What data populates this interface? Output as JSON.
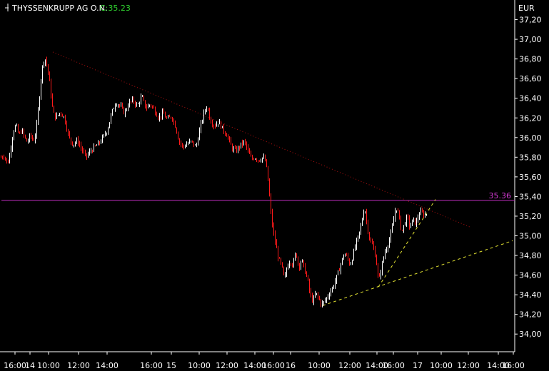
{
  "header": {
    "title": "THYSSENKRUPP AG O.N.",
    "close_label": "C:35.23"
  },
  "currency": "EUR",
  "colors": {
    "background": "#000000",
    "up": "#ffffff",
    "down": "#ff1a1a",
    "close_text": "#2fd12f",
    "hline": "#c02ec0",
    "resistance": "#b01010",
    "support": "#e6e632"
  },
  "chart_data": {
    "type": "candlestick",
    "title": "THYSSENKRUPP AG O.N.",
    "last_close": 35.23,
    "ylabel": "EUR",
    "ylim": [
      33.82,
      37.4
    ],
    "y_ticks": [
      "37,20",
      "37,00",
      "36,80",
      "36,60",
      "36,40",
      "36,20",
      "36,00",
      "35,80",
      "35,60",
      "35,40",
      "35,20",
      "35,00",
      "34,80",
      "34,60",
      "34,40",
      "34,20",
      "34,00"
    ],
    "x_ticks": [
      "16:00",
      "14",
      "10:00",
      "12:00",
      "14:00",
      "16:00",
      "15",
      "10:00",
      "12:00",
      "14:00",
      "16:00",
      "16",
      "10:00",
      "12:00",
      "14:00",
      "16:00",
      "17",
      "10:00",
      "12:00",
      "14:00",
      "16:00"
    ],
    "horizontal_line": {
      "value": 35.36,
      "label": "35.36"
    },
    "trendlines": [
      {
        "name": "resistance",
        "style": "dotted",
        "from": [
          74,
          36.87
        ],
        "to": [
          658,
          35.09
        ]
      },
      {
        "name": "support",
        "style": "dashed",
        "from": [
          452,
          34.29
        ],
        "to": [
          718,
          34.95
        ]
      },
      {
        "name": "support-short",
        "style": "dashed",
        "from": [
          530,
          34.48
        ],
        "to": [
          610,
          35.37
        ]
      }
    ],
    "anchors": [
      [
        1,
        35.8
      ],
      [
        6,
        35.82
      ],
      [
        10,
        35.72
      ],
      [
        14,
        35.86
      ],
      [
        18,
        36.06
      ],
      [
        22,
        36.13
      ],
      [
        26,
        36.02
      ],
      [
        30,
        36.08
      ],
      [
        34,
        36.0
      ],
      [
        38,
        35.95
      ],
      [
        42,
        36.03
      ],
      [
        46,
        35.96
      ],
      [
        50,
        36.05
      ],
      [
        54,
        36.35
      ],
      [
        58,
        36.68
      ],
      [
        62,
        36.82
      ],
      [
        66,
        36.72
      ],
      [
        70,
        36.5
      ],
      [
        74,
        36.25
      ],
      [
        78,
        36.2
      ],
      [
        84,
        36.26
      ],
      [
        90,
        36.2
      ],
      [
        96,
        36.0
      ],
      [
        102,
        35.93
      ],
      [
        108,
        35.97
      ],
      [
        114,
        35.88
      ],
      [
        120,
        35.8
      ],
      [
        126,
        35.86
      ],
      [
        132,
        35.9
      ],
      [
        138,
        35.94
      ],
      [
        144,
        36.0
      ],
      [
        150,
        36.08
      ],
      [
        156,
        36.25
      ],
      [
        162,
        36.36
      ],
      [
        168,
        36.32
      ],
      [
        174,
        36.25
      ],
      [
        180,
        36.35
      ],
      [
        186,
        36.38
      ],
      [
        192,
        36.32
      ],
      [
        198,
        36.42
      ],
      [
        204,
        36.3
      ],
      [
        210,
        36.34
      ],
      [
        216,
        36.28
      ],
      [
        222,
        36.2
      ],
      [
        228,
        36.25
      ],
      [
        234,
        36.18
      ],
      [
        240,
        36.22
      ],
      [
        246,
        36.1
      ],
      [
        250,
        35.97
      ],
      [
        256,
        35.9
      ],
      [
        262,
        35.94
      ],
      [
        268,
        35.96
      ],
      [
        274,
        35.9
      ],
      [
        280,
        36.1
      ],
      [
        286,
        36.27
      ],
      [
        290,
        36.32
      ],
      [
        294,
        36.18
      ],
      [
        300,
        36.12
      ],
      [
        306,
        36.16
      ],
      [
        312,
        36.08
      ],
      [
        318,
        36.02
      ],
      [
        324,
        35.9
      ],
      [
        330,
        35.86
      ],
      [
        336,
        35.92
      ],
      [
        342,
        35.96
      ],
      [
        348,
        35.84
      ],
      [
        352,
        35.78
      ],
      [
        356,
        35.8
      ],
      [
        362,
        35.77
      ],
      [
        368,
        35.8
      ],
      [
        372,
        35.75
      ],
      [
        376,
        35.5
      ],
      [
        378,
        35.3
      ],
      [
        382,
        35.05
      ],
      [
        386,
        34.9
      ],
      [
        390,
        34.76
      ],
      [
        394,
        34.7
      ],
      [
        398,
        34.55
      ],
      [
        402,
        34.7
      ],
      [
        406,
        34.75
      ],
      [
        410,
        34.7
      ],
      [
        414,
        34.84
      ],
      [
        418,
        34.68
      ],
      [
        422,
        34.76
      ],
      [
        426,
        34.66
      ],
      [
        430,
        34.57
      ],
      [
        434,
        34.4
      ],
      [
        438,
        34.33
      ],
      [
        442,
        34.42
      ],
      [
        446,
        34.36
      ],
      [
        450,
        34.3
      ],
      [
        454,
        34.33
      ],
      [
        458,
        34.38
      ],
      [
        462,
        34.43
      ],
      [
        466,
        34.48
      ],
      [
        470,
        34.56
      ],
      [
        474,
        34.64
      ],
      [
        478,
        34.74
      ],
      [
        482,
        34.82
      ],
      [
        486,
        34.78
      ],
      [
        490,
        34.7
      ],
      [
        494,
        34.8
      ],
      [
        498,
        34.92
      ],
      [
        502,
        35.0
      ],
      [
        506,
        35.13
      ],
      [
        510,
        35.3
      ],
      [
        514,
        35.1
      ],
      [
        518,
        34.94
      ],
      [
        522,
        34.9
      ],
      [
        526,
        34.78
      ],
      [
        530,
        34.53
      ],
      [
        534,
        34.68
      ],
      [
        538,
        34.82
      ],
      [
        542,
        34.9
      ],
      [
        546,
        34.98
      ],
      [
        550,
        35.12
      ],
      [
        554,
        35.3
      ],
      [
        558,
        35.22
      ],
      [
        562,
        35.04
      ],
      [
        566,
        35.12
      ],
      [
        570,
        35.2
      ],
      [
        574,
        35.08
      ],
      [
        578,
        35.17
      ],
      [
        582,
        35.12
      ],
      [
        586,
        35.22
      ],
      [
        590,
        35.24
      ],
      [
        594,
        35.21
      ],
      [
        598,
        35.23
      ]
    ]
  }
}
